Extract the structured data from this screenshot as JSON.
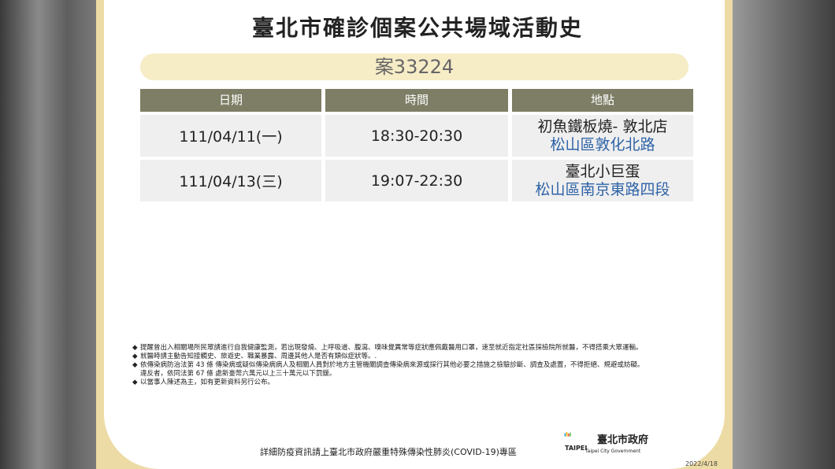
{
  "title": "臺北市確診個案公共場域活動史",
  "case_label": "案33224",
  "table": {
    "headers": [
      "日期",
      "時間",
      "地點"
    ],
    "rows": [
      {
        "date": "111/04/11(一)",
        "time": "18:30-20:30",
        "place": "初魚鐵板燒- 敦北店",
        "address": "松山區敦化北路"
      },
      {
        "date": "111/04/13(三)",
        "time": "19:07-22:30",
        "place": "臺北小巨蛋",
        "address": "松山區南京東路四段"
      }
    ]
  },
  "notes": [
    "提醒曾出入相關場所民眾請進行自我健康監測，若出現發燒、上呼吸道、腹瀉、嗅味覺異常等症狀應佩戴醫用口罩，速至就近指定社區採檢院所就醫，不得搭乘大眾運輸。",
    "就醫時請主動告知接觸史、旅遊史、職業暴露、周邊其他人是否有類似症狀等。.",
    "依傳染病防治法第 43 條 傳染病或疑似傳染病病人及相關人員對於地方主管機關調查傳染病來源或採行其他必要之措施之檢驗診斷、調查及處置，不得拒絕、規避或妨礙。",
    "以當事人陳述為主，如有更新資料另行公布。"
  ],
  "penalty_note": "違反者，依同法第 67 條 處新臺幣六萬元以上三十萬元以下罰鍰。",
  "bullet": "◆",
  "footer": "詳細防疫資訊請上臺北市政府嚴重特殊傳染性肺炎(COVID-19)專區",
  "logo": {
    "name": "臺北市政府",
    "word": "TAIPEI",
    "english": "Taipei City Government"
  },
  "date": "2022/4/18",
  "colors": {
    "frame": "#ecdba4",
    "header": "#7d7e65",
    "address": "#2e63a7",
    "pill": "#f6ecc6"
  }
}
